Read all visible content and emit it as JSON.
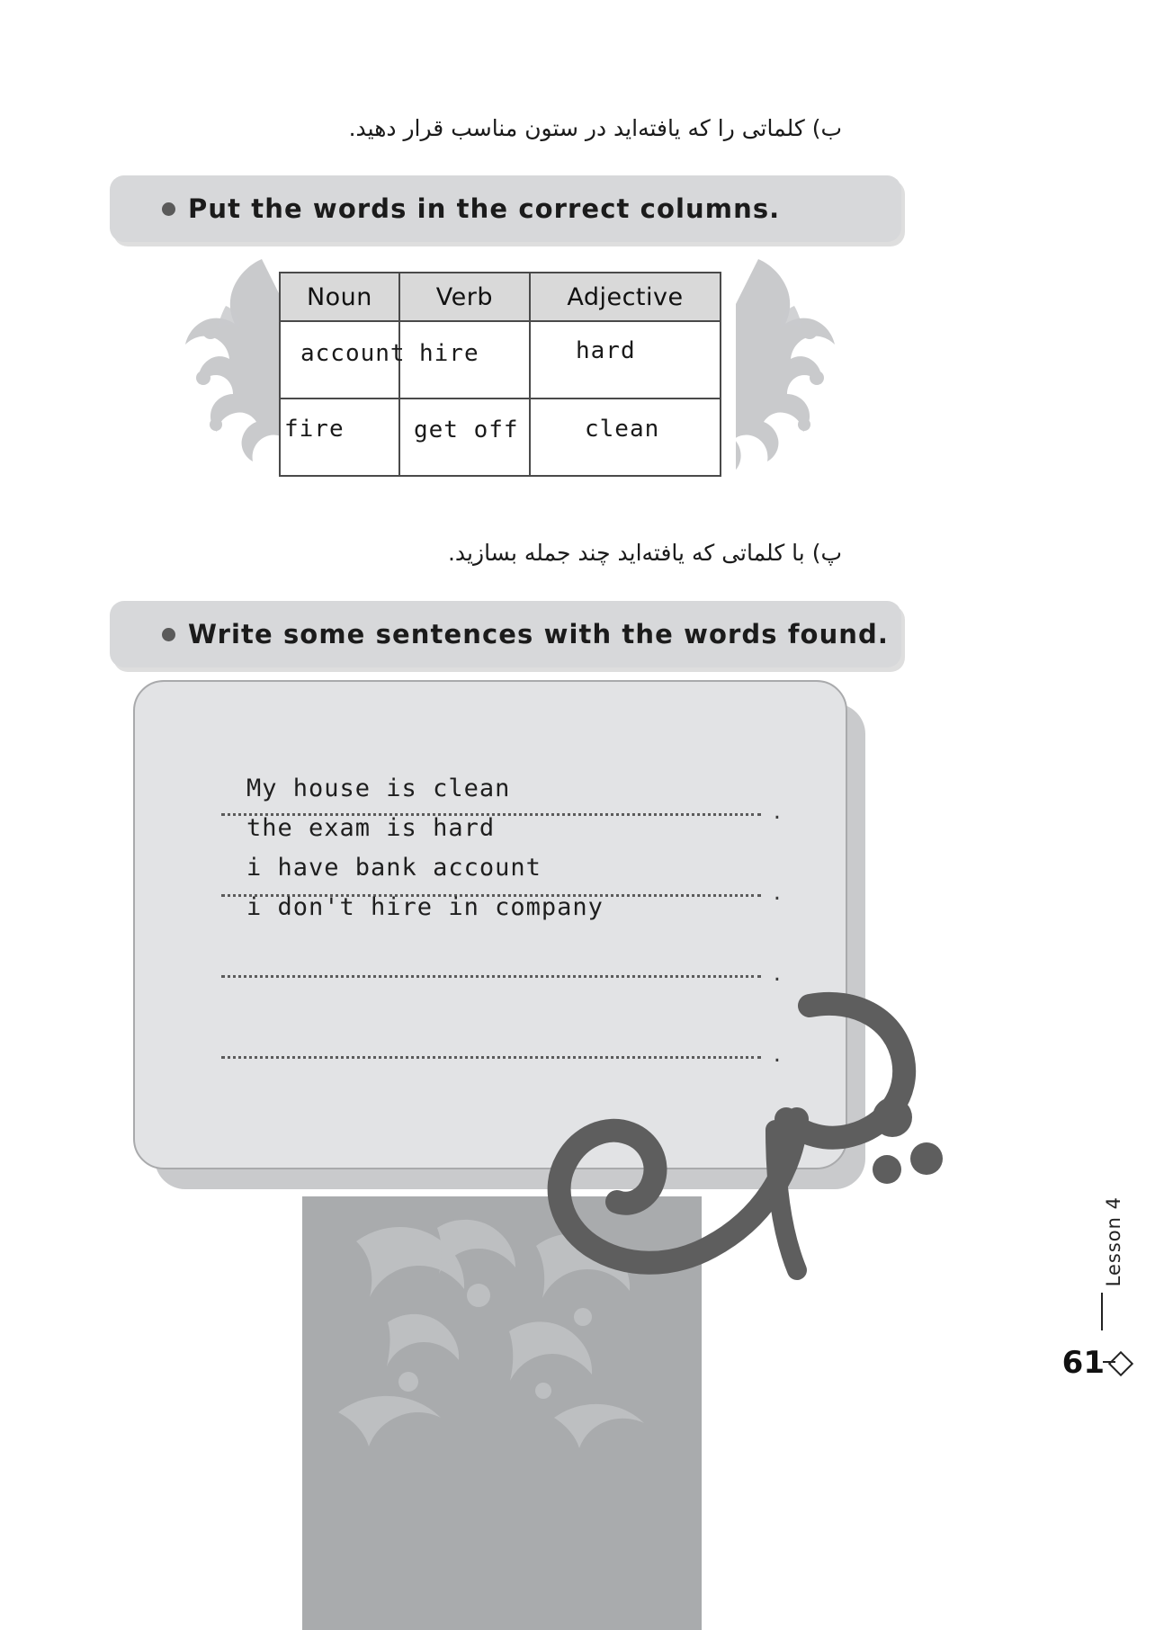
{
  "page": {
    "number": "61",
    "lesson_label": "Lesson 4",
    "watermark_text": "گاج",
    "bg_color": "#ffffff"
  },
  "sections": [
    {
      "persian_prompt": "ب) کلماتی را که یافته‌اید در ستون مناسب قرار دهید.",
      "english_instruction": "Put the words in the correct columns."
    },
    {
      "persian_prompt": "پ) با کلماتی که یافته‌اید چند جمله بسازید.",
      "english_instruction": "Write some sentences with the words found."
    }
  ],
  "word_table": {
    "headers": [
      "Noun",
      "Verb",
      "Adjective"
    ],
    "header_bg": "#d9d9d9",
    "border_color": "#4a4a4a",
    "rows": [
      {
        "noun": "account",
        "verb": "hire",
        "adjective": "hard"
      },
      {
        "noun": "fire",
        "verb": "get off",
        "adjective": "clean"
      }
    ]
  },
  "sentence_card": {
    "bg_color": "#e2e3e5",
    "line_count": 6,
    "answers": [
      "My house is clean",
      "the exam is  hard",
      "i have bank account",
      "i don't hire in company",
      "",
      ""
    ],
    "line_end_mark": "."
  }
}
